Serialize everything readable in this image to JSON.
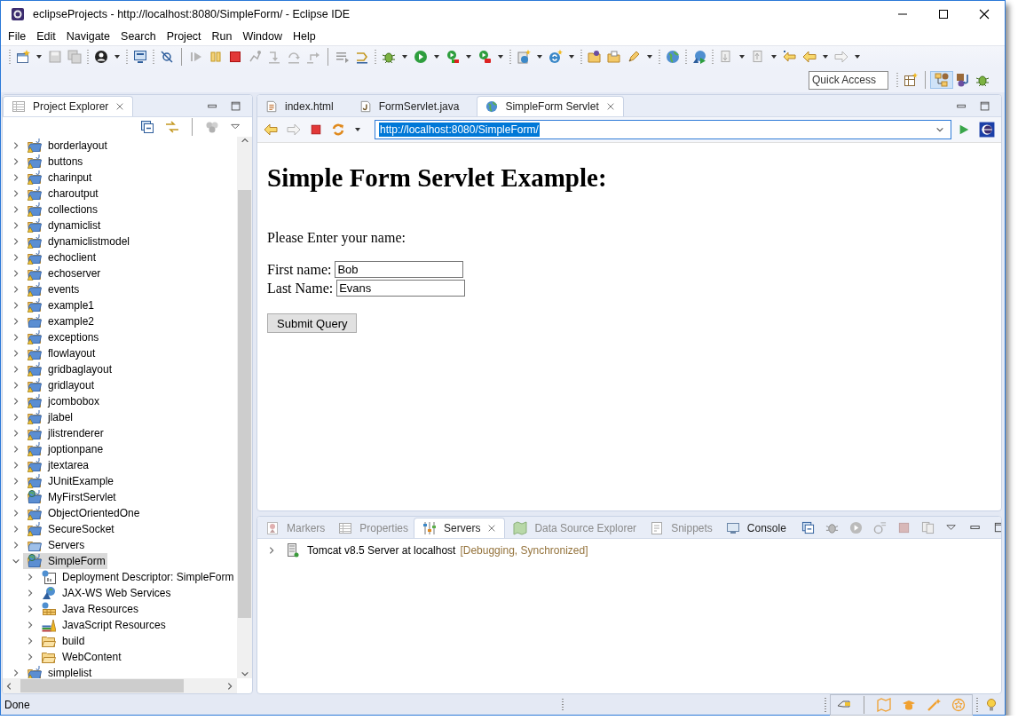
{
  "window": {
    "title": "eclipseProjects - http://localhost:8080/SimpleForm/ - Eclipse IDE"
  },
  "menu": [
    "File",
    "Edit",
    "Navigate",
    "Search",
    "Project",
    "Run",
    "Window",
    "Help"
  ],
  "quick_access": {
    "placeholder": "Quick Access"
  },
  "project_explorer": {
    "title": "Project Explorer",
    "tree": [
      {
        "label": "borderlayout",
        "kind": "project",
        "warning": true,
        "expanded": false,
        "selected": false
      },
      {
        "label": "buttons",
        "kind": "project",
        "warning": true,
        "expanded": false,
        "selected": false
      },
      {
        "label": "charinput",
        "kind": "project",
        "warning": true,
        "expanded": false,
        "selected": false
      },
      {
        "label": "charoutput",
        "kind": "project",
        "warning": true,
        "expanded": false,
        "selected": false
      },
      {
        "label": "collections",
        "kind": "project",
        "warning": true,
        "expanded": false,
        "selected": false
      },
      {
        "label": "dynamiclist",
        "kind": "project",
        "warning": true,
        "expanded": false,
        "selected": false
      },
      {
        "label": "dynamiclistmodel",
        "kind": "project",
        "warning": true,
        "expanded": false,
        "selected": false
      },
      {
        "label": "echoclient",
        "kind": "project",
        "warning": true,
        "expanded": false,
        "selected": false
      },
      {
        "label": "echoserver",
        "kind": "project",
        "warning": true,
        "expanded": false,
        "selected": false
      },
      {
        "label": "events",
        "kind": "project",
        "warning": true,
        "expanded": false,
        "selected": false
      },
      {
        "label": "example1",
        "kind": "project",
        "warning": true,
        "expanded": false,
        "selected": false
      },
      {
        "label": "example2",
        "kind": "project",
        "warning": false,
        "expanded": false,
        "selected": false
      },
      {
        "label": "exceptions",
        "kind": "project",
        "warning": true,
        "expanded": false,
        "selected": false
      },
      {
        "label": "flowlayout",
        "kind": "project",
        "warning": true,
        "expanded": false,
        "selected": false
      },
      {
        "label": "gridbaglayout",
        "kind": "project",
        "warning": true,
        "expanded": false,
        "selected": false
      },
      {
        "label": "gridlayout",
        "kind": "project",
        "warning": true,
        "expanded": false,
        "selected": false
      },
      {
        "label": "jcombobox",
        "kind": "project",
        "warning": true,
        "expanded": false,
        "selected": false
      },
      {
        "label": "jlabel",
        "kind": "project",
        "warning": true,
        "expanded": false,
        "selected": false
      },
      {
        "label": "jlistrenderer",
        "kind": "project",
        "warning": true,
        "expanded": false,
        "selected": false
      },
      {
        "label": "joptionpane",
        "kind": "project",
        "warning": true,
        "expanded": false,
        "selected": false
      },
      {
        "label": "jtextarea",
        "kind": "project",
        "warning": true,
        "expanded": false,
        "selected": false
      },
      {
        "label": "JUnitExample",
        "kind": "project",
        "warning": true,
        "expanded": false,
        "selected": false
      },
      {
        "label": "MyFirstServlet",
        "kind": "web-project",
        "warning": false,
        "expanded": false,
        "selected": false
      },
      {
        "label": "ObjectOrientedOne",
        "kind": "project",
        "warning": true,
        "expanded": false,
        "selected": false
      },
      {
        "label": "SecureSocket",
        "kind": "project",
        "warning": true,
        "expanded": false,
        "selected": false
      },
      {
        "label": "Servers",
        "kind": "folder",
        "warning": false,
        "expanded": false,
        "selected": false
      },
      {
        "label": "SimpleForm",
        "kind": "web-project",
        "warning": false,
        "expanded": true,
        "selected": true,
        "children": [
          {
            "label": "Deployment Descriptor: SimpleForm",
            "kind": "descriptor",
            "warning": false,
            "expanded": false,
            "selected": false
          },
          {
            "label": "JAX-WS Web Services",
            "kind": "webservices",
            "warning": false,
            "expanded": false,
            "selected": false
          },
          {
            "label": "Java Resources",
            "kind": "java-resources",
            "warning": false,
            "expanded": false,
            "selected": false
          },
          {
            "label": "JavaScript Resources",
            "kind": "js-resources",
            "warning": false,
            "expanded": false,
            "selected": false
          },
          {
            "label": "build",
            "kind": "plain-folder",
            "warning": false,
            "expanded": false,
            "selected": false
          },
          {
            "label": "WebContent",
            "kind": "plain-folder",
            "warning": false,
            "expanded": false,
            "selected": false
          }
        ]
      },
      {
        "label": "simplelist",
        "kind": "project",
        "warning": true,
        "expanded": false,
        "selected": false
      }
    ]
  },
  "editor": {
    "tabs": [
      {
        "label": "index.html",
        "kind": "html",
        "selected": false
      },
      {
        "label": "FormServlet.java",
        "kind": "java",
        "selected": false
      },
      {
        "label": "SimpleForm Servlet",
        "kind": "browser",
        "selected": true
      }
    ],
    "browser": {
      "url": "http://localhost:8080/SimpleForm/",
      "url_selected": true,
      "page": {
        "heading": "Simple Form Servlet Example:",
        "prompt": "Please Enter your name:",
        "fields": [
          {
            "label": "First name:",
            "value": "Bob"
          },
          {
            "label": "Last Name:",
            "value": "Evans"
          }
        ],
        "button": "Submit Query"
      }
    }
  },
  "bottom_panel": {
    "tabs": [
      {
        "label": "Markers",
        "kind": "markers",
        "selected": false
      },
      {
        "label": "Properties",
        "kind": "properties",
        "selected": false
      },
      {
        "label": "Servers",
        "kind": "servers",
        "selected": true
      },
      {
        "label": "Data Source Explorer",
        "kind": "datasource",
        "selected": false
      },
      {
        "label": "Snippets",
        "kind": "snippets",
        "selected": false
      },
      {
        "label": "Console",
        "kind": "console",
        "selected": false
      }
    ],
    "servers": [
      {
        "name": "Tomcat v8.5 Server at localhost",
        "state": "[Debugging, Synchronized]",
        "expanded": false
      }
    ]
  },
  "status_bar": {
    "message": "Done"
  }
}
